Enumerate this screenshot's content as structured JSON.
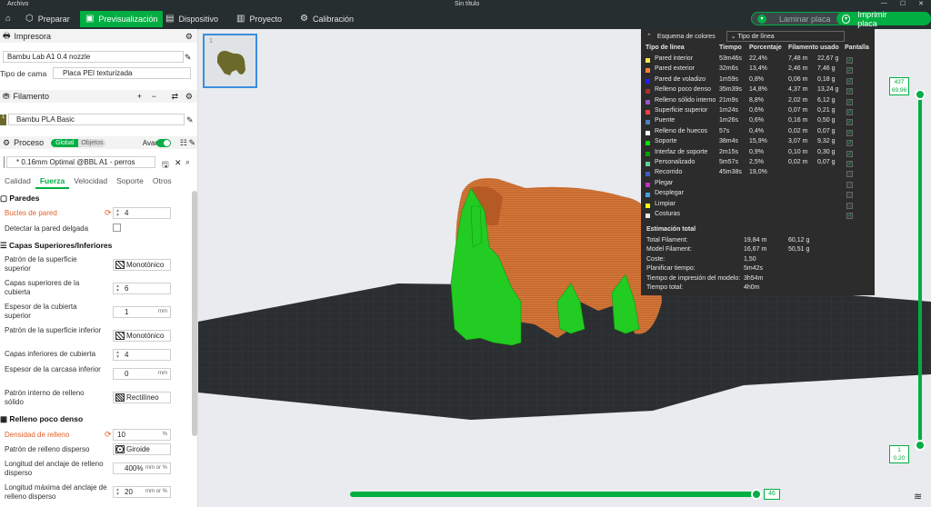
{
  "titlebar": {
    "menu": "Archivo",
    "title": "Sin título"
  },
  "nav": {
    "prepare": "Preparar",
    "preview": "Previsualización",
    "device": "Dispositivo",
    "project": "Proyecto",
    "calibration": "Calibración"
  },
  "actions": {
    "slice": "Laminar placa",
    "print": "Imprimir placa"
  },
  "printer": {
    "header": "Impresora",
    "name": "Bambu Lab A1 0.4 nozzle",
    "bed_label": "Tipo de cama",
    "bed_value": "Placa PEI texturizada"
  },
  "filament": {
    "header": "Filamento",
    "slot": "1",
    "name": "Bambu PLA Basic"
  },
  "process": {
    "header": "Proceso",
    "global": "Global",
    "objects": "Objetos",
    "advanced": "Avanzar",
    "preset": "* 0.16mm Optimal @BBL A1 - perros"
  },
  "tabs": [
    "Calidad",
    "Fuerza",
    "Velocidad",
    "Soporte",
    "Otros"
  ],
  "walls": {
    "title": "Paredes",
    "loops_label": "Bucles de pared",
    "loops": "4",
    "thin_label": "Detectar la pared delgada"
  },
  "shells": {
    "title": "Capas Superiores/Inferiores",
    "top_pattern_label": "Patrón de la superficie superior",
    "top_pattern": "Monotónico",
    "top_layers_label": "Capas superiores de la cubierta",
    "top_layers": "6",
    "top_thick_label": "Espesor de la cubierta superior",
    "top_thick": "1",
    "top_thick_unit": "mm",
    "bot_pattern_label": "Patrón de la superficie inferior",
    "bot_pattern": "Monotónico",
    "bot_layers_label": "Capas inferiores de cubierta",
    "bot_layers": "4",
    "bot_thick_label": "Espesor de la carcasa inferior",
    "bot_thick": "0",
    "bot_thick_unit": "mm",
    "solid_pattern_label": "Patrón interno de relleno sólido",
    "solid_pattern": "Rectilíneo"
  },
  "infill": {
    "title": "Relleno poco denso",
    "density_label": "Densidad de relleno",
    "density": "10",
    "density_unit": "%",
    "pattern_label": "Patrón de relleno disperso",
    "pattern": "Giroide",
    "anchor_label": "Longitud del anclaje de relleno disperso",
    "anchor": "400%",
    "anchor_unit": "mm or %",
    "anchor_max_label": "Longitud máxima del anclaje de relleno disperso",
    "anchor_max": "20",
    "anchor_max_unit": "mm or %"
  },
  "legend": {
    "title": "Esquema de colores",
    "select": "Tipo de línea",
    "cols": [
      "Tipo de línea",
      "Tiempo",
      "Porcentaje",
      "Filamento usado",
      "Pantalla"
    ],
    "rows": [
      {
        "name": "Pared interior",
        "time": "53m46s",
        "pct": "22,4%",
        "fm": "7,48 m",
        "fg": "22,67 g",
        "color": "#ffe34d",
        "on": true
      },
      {
        "name": "Pared exterior",
        "time": "32m6s",
        "pct": "13,4%",
        "fm": "2,46 m",
        "fg": "7,46 g",
        "color": "#ff7d38",
        "on": true
      },
      {
        "name": "Pared de voladizo",
        "time": "1m59s",
        "pct": "0,8%",
        "fm": "0,06 m",
        "fg": "0,18 g",
        "color": "#1f1fff",
        "on": true
      },
      {
        "name": "Relleno poco denso",
        "time": "35m39s",
        "pct": "14,8%",
        "fm": "4,37 m",
        "fg": "13,24 g",
        "color": "#b03029",
        "on": true
      },
      {
        "name": "Relleno sólido interno",
        "time": "21m9s",
        "pct": "8,8%",
        "fm": "2,02 m",
        "fg": "6,12 g",
        "color": "#9654cc",
        "on": true
      },
      {
        "name": "Superficie superior",
        "time": "1m24s",
        "pct": "0,6%",
        "fm": "0,07 m",
        "fg": "0,21 g",
        "color": "#f04040",
        "on": true
      },
      {
        "name": "Puente",
        "time": "1m26s",
        "pct": "0,6%",
        "fm": "0,16 m",
        "fg": "0,50 g",
        "color": "#4d80ba",
        "on": true
      },
      {
        "name": "Relleno de huecos",
        "time": "57s",
        "pct": "0,4%",
        "fm": "0,02 m",
        "fg": "0,07 g",
        "color": "#ffffff",
        "on": true
      },
      {
        "name": "Soporte",
        "time": "38m4s",
        "pct": "15,9%",
        "fm": "3,07 m",
        "fg": "9,32 g",
        "color": "#00e000",
        "on": true
      },
      {
        "name": "Interfaz de soporte",
        "time": "2m15s",
        "pct": "0,9%",
        "fm": "0,10 m",
        "fg": "0,30 g",
        "color": "#00a000",
        "on": true
      },
      {
        "name": "Personalizado",
        "time": "5m57s",
        "pct": "2,5%",
        "fm": "0,02 m",
        "fg": "0,07 g",
        "color": "#5ed194",
        "on": true
      },
      {
        "name": "Recorrido",
        "time": "45m38s",
        "pct": "19,0%",
        "fm": "",
        "fg": "",
        "color": "#3b5ec4",
        "on": false
      },
      {
        "name": "Plegar",
        "time": "",
        "pct": "",
        "fm": "",
        "fg": "",
        "color": "#c030c0",
        "on": false
      },
      {
        "name": "Desplegar",
        "time": "",
        "pct": "",
        "fm": "",
        "fg": "",
        "color": "#3fa2e0",
        "on": false
      },
      {
        "name": "Limpiar",
        "time": "",
        "pct": "",
        "fm": "",
        "fg": "",
        "color": "#ffff00",
        "on": false
      },
      {
        "name": "Costuras",
        "time": "",
        "pct": "",
        "fm": "",
        "fg": "",
        "color": "#e6e6e6",
        "on": true
      }
    ],
    "est_title": "Estimación total",
    "est": [
      {
        "k": "Total Filament:",
        "a": "19,84 m",
        "b": "60,12 g"
      },
      {
        "k": "Model Filament:",
        "a": "16,67 m",
        "b": "50,51 g"
      },
      {
        "k": "Coste:",
        "a": "1,50",
        "b": ""
      },
      {
        "k": "Planificar tiempo:",
        "a": "5m42s",
        "b": ""
      },
      {
        "k": "Tiempo de impresión del modelo:",
        "a": "3h54m",
        "b": ""
      },
      {
        "k": "Tiempo total:",
        "a": "4h0m",
        "b": ""
      }
    ]
  },
  "layer_slider": {
    "top_layer": "437",
    "top_height": "69,96",
    "bottom_layer": "1",
    "bottom_height": "0,20"
  },
  "move_slider": {
    "value": "46"
  },
  "plate": {
    "number": "1"
  }
}
